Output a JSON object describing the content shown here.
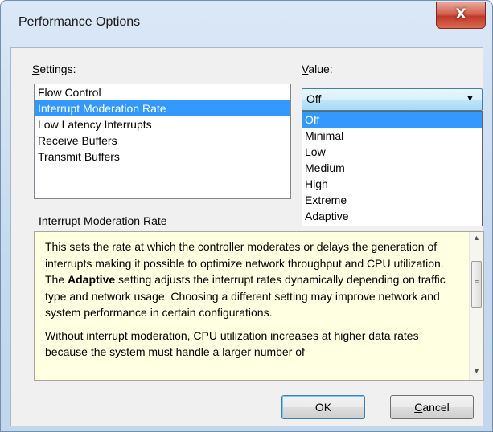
{
  "window": {
    "title": "Performance Options",
    "close_glyph": "X"
  },
  "settings": {
    "label": "Settings:",
    "items": [
      {
        "label": "Flow Control",
        "selected": false
      },
      {
        "label": "Interrupt Moderation Rate",
        "selected": true
      },
      {
        "label": "Low Latency Interrupts",
        "selected": false
      },
      {
        "label": "Receive Buffers",
        "selected": false
      },
      {
        "label": "Transmit Buffers",
        "selected": false
      }
    ]
  },
  "value": {
    "label": "Value:",
    "current": "Off",
    "options": [
      "Off",
      "Minimal",
      "Low",
      "Medium",
      "High",
      "Extreme",
      "Adaptive"
    ]
  },
  "description": {
    "title": "Interrupt Moderation Rate",
    "p1_before": "This sets the rate at which the controller moderates or delays the generation of interrupts making it possible to optimize network throughput and CPU utilization. The ",
    "p1_bold": "Adaptive",
    "p1_after": " setting adjusts the interrupt rates dynamically depending on traffic type and network usage. Choosing a different setting may improve network and system performance in certain configurations.",
    "p2": "Without interrupt moderation, CPU utilization increases at higher data rates because the system must handle a larger number of"
  },
  "buttons": {
    "ok": "OK",
    "cancel": "Cancel"
  },
  "colors": {
    "selection": "#3399ff",
    "description_bg": "#ffffe1",
    "close_button": "#c2382a"
  }
}
